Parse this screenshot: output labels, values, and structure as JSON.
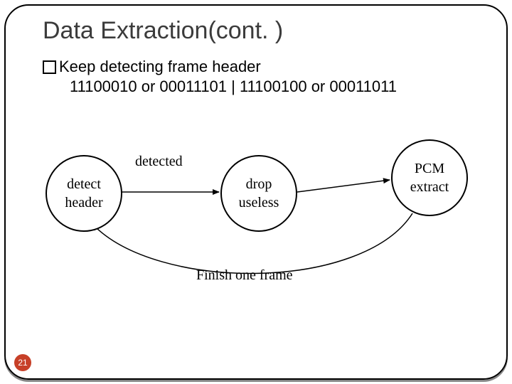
{
  "slide": {
    "title": "Data Extraction(cont. )",
    "bullet": "Keep detecting frame header",
    "code_line": "11100010 or 00011101 | 11100100 or 00011011",
    "page_number": "21"
  },
  "diagram": {
    "states": {
      "detect": {
        "line1": "detect",
        "line2": "header"
      },
      "drop": {
        "line1": "drop",
        "line2": "useless"
      },
      "extract": {
        "line1": "PCM",
        "line2": "extract"
      }
    },
    "edges": {
      "detected": "detected",
      "finish": "Finish one frame"
    }
  }
}
